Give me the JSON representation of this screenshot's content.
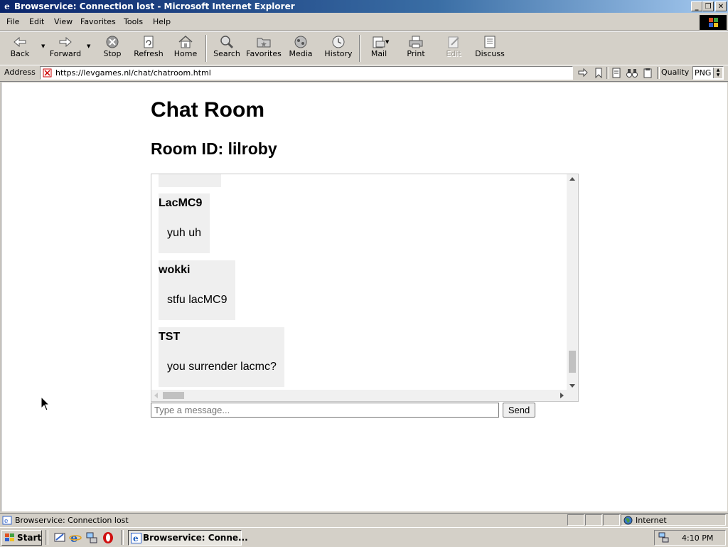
{
  "window": {
    "title": "Browservice: Connection lost - Microsoft Internet Explorer",
    "controls": [
      "minimize",
      "restore",
      "close"
    ]
  },
  "menu": [
    "File",
    "Edit",
    "View",
    "Favorites",
    "Tools",
    "Help"
  ],
  "toolbar": {
    "back": "Back",
    "forward": "Forward",
    "stop": "Stop",
    "refresh": "Refresh",
    "home": "Home",
    "search": "Search",
    "favorites": "Favorites",
    "media": "Media",
    "history": "History",
    "mail": "Mail",
    "print": "Print",
    "edit": "Edit",
    "discuss": "Discuss"
  },
  "address": {
    "label": "Address",
    "url": "https://levgames.nl/chat/chatroom.html",
    "quality_label": "Quality",
    "quality_value": "PNG"
  },
  "page": {
    "title": "Chat Room",
    "room_line": "Room ID: lilroby",
    "messages": [
      {
        "user": "LacMC9",
        "text": "yuh uh"
      },
      {
        "user": "wokki",
        "text": "stfu lacMC9"
      },
      {
        "user": "TST",
        "text": "you surrender lacmc?"
      }
    ],
    "input_placeholder": "Type a message...",
    "send_label": "Send"
  },
  "status": {
    "text": "Browservice: Connection lost",
    "zone": "Internet"
  },
  "taskbar": {
    "start": "Start",
    "task": "Browservice: Conne...",
    "clock": "4:10 PM"
  }
}
